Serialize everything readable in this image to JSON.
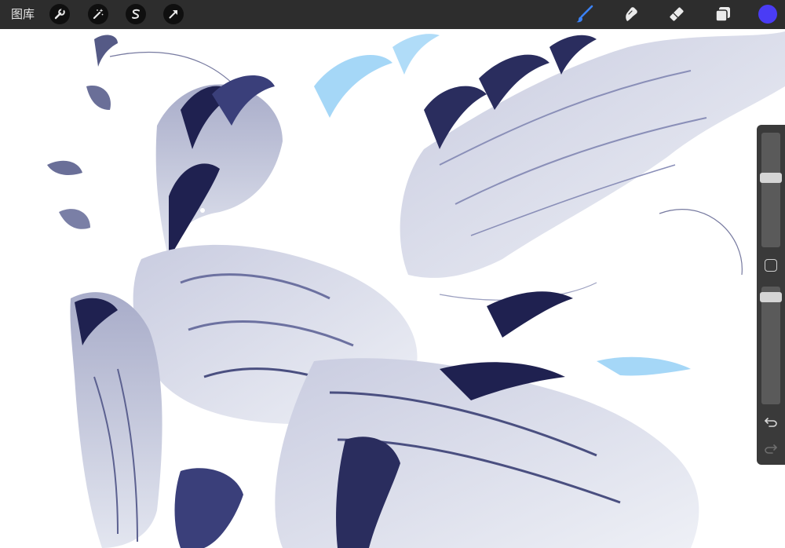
{
  "toolbar": {
    "gallery_label": "图库",
    "left_tools": [
      {
        "name": "actions-wrench-icon"
      },
      {
        "name": "adjustments-wand-icon"
      },
      {
        "name": "selection-s-icon"
      },
      {
        "name": "transform-arrow-icon"
      }
    ],
    "right_tools": [
      {
        "name": "brush-icon",
        "active": true,
        "color": "#3b82f6"
      },
      {
        "name": "smudge-icon",
        "active": false
      },
      {
        "name": "eraser-icon",
        "active": false
      },
      {
        "name": "layers-icon",
        "active": false
      }
    ],
    "current_color": "#4a3cf5"
  },
  "sidebar": {
    "brush_size_level": 0.62,
    "opacity_level": 0.95
  },
  "colors": {
    "toolbar_bg": "#2d2d2d",
    "canvas_bg": "#ffffff",
    "accent_blue": "#3b82f6",
    "art_dark": "#1f2150",
    "art_mid": "#8a8fb8",
    "art_light": "#d8dbe8",
    "art_cyan": "#7cc4f0"
  }
}
